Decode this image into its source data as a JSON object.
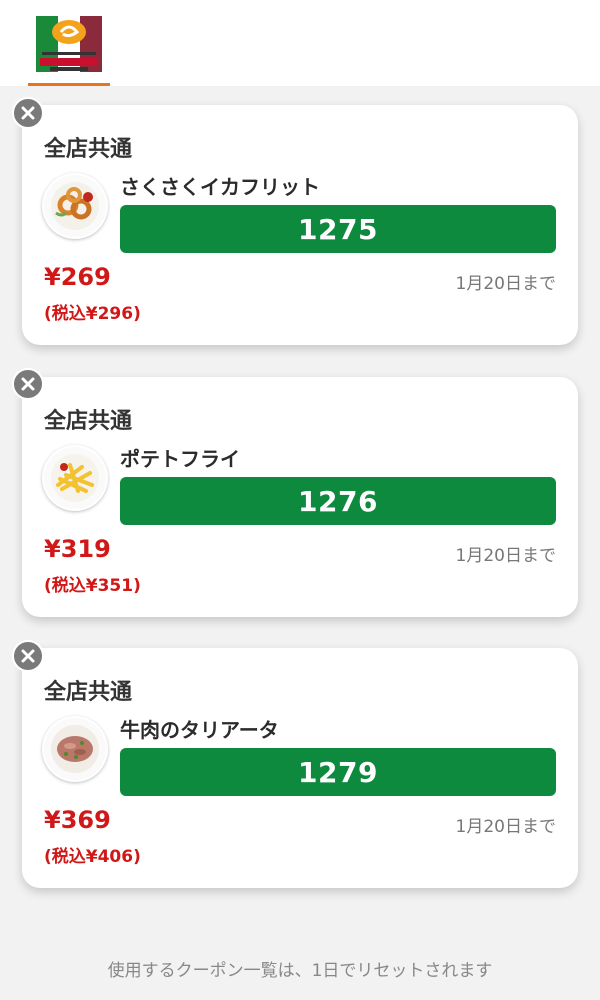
{
  "header": {
    "logo_icon": "grazie-gardens-logo",
    "logo_text_top": "PASTA・PIZZA",
    "logo_text_main": "グラッチェ",
    "logo_text_sub": "ガーデンズ"
  },
  "coupons": [
    {
      "store": "全店共通",
      "item": "さくさくイカフリット",
      "code": "1275",
      "price": "¥269",
      "price_tax": "(税込¥296)",
      "expiry": "1月20日まで",
      "image_icon": "squid-fritter-plate-icon"
    },
    {
      "store": "全店共通",
      "item": "ポテトフライ",
      "code": "1276",
      "price": "¥319",
      "price_tax": "(税込¥351)",
      "expiry": "1月20日まで",
      "image_icon": "french-fries-plate-icon"
    },
    {
      "store": "全店共通",
      "item": "牛肉のタリアータ",
      "code": "1279",
      "price": "¥369",
      "price_tax": "(税込¥406)",
      "expiry": "1月20日まで",
      "image_icon": "beef-tagliata-plate-icon"
    }
  ],
  "footer": {
    "note": "使用するクーポン一覧は、1日でリセットされます"
  },
  "colors": {
    "accent_orange": "#e8731c",
    "code_green": "#0d8a3d",
    "price_red": "#d01818",
    "close_gray": "#7a7a7a"
  }
}
